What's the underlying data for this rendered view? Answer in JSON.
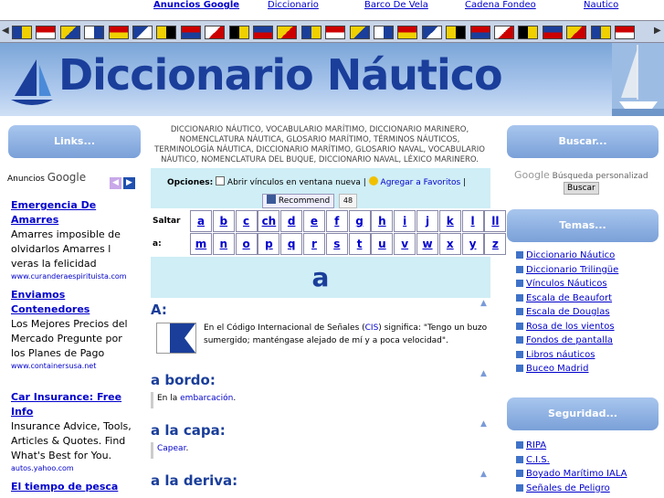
{
  "topnav": {
    "items": [
      "Anuncios Google",
      "Diccionario",
      "Barco De Vela",
      "Cadena Fondeo",
      "Nautico"
    ]
  },
  "banner": {
    "title": "Diccionario Náutico"
  },
  "left": {
    "links_label": "Links...",
    "ads_label_prefix": "Anuncios",
    "ads_label_brand": "Google",
    "ads": [
      {
        "headline": "Emergencia De Amarres",
        "body": "Amarres imposible de olvidarlos Amarres l veras la felicidad",
        "url": "www.curanderaespirituista.com"
      },
      {
        "headline": "Enviamos Contenedores",
        "body": "Los Mejores Precios del Mercado Pregunte por los Planes de Pago",
        "url": "www.containersusa.net"
      },
      {
        "headline": "Car Insurance: Free Info",
        "body": "Insurance Advice, Tools, Articles & Quotes. Find What's Best for You.",
        "url": "autos.yahoo.com"
      },
      {
        "headline": "El tiempo de pesca",
        "body": "",
        "url": ""
      }
    ]
  },
  "center": {
    "description": "DICCIONARIO NÁUTICO, VOCABULARIO MARÍTIMO, DICCIONARIO MARINERO, NOMENCLATURA NÁUTICA, GLOSARIO MARÍTIMO, TÉRMINOS NÁUTICOS, TERMINOLOGÍA NÁUTICA, DICCIONARIO MARÍTIMO, GLOSARIO NAVAL, VOCABULARIO NÁUTICO, NOMENCLATURA DEL BUQUE, DICCIONARIO NAVAL, LÉXICO MARINERO.",
    "options_label": "Opciones:",
    "new_window_label": "Abrir vínculos en ventana nueva |",
    "favorites_label": "Agregar a Favoritos",
    "fb_label": "Recommend",
    "fb_count": "48",
    "jump_label": "Saltar a:",
    "letters_row1": [
      "a",
      "b",
      "c",
      "ch",
      "d",
      "e",
      "f",
      "g",
      "h",
      "i",
      "j",
      "k",
      "l",
      "ll"
    ],
    "letters_row2": [
      "m",
      "n",
      "o",
      "p",
      "q",
      "r",
      "s",
      "t",
      "u",
      "v",
      "w",
      "x",
      "y",
      "z"
    ],
    "current_letter": "a",
    "entries": [
      {
        "term": "A:",
        "definition_pre": "En el Código Internacional de Señales (",
        "definition_link": "CIS",
        "definition_post": ") significa: \"Tengo un buzo sumergido; manténgase alejado de mí y a poca velocidad\"."
      },
      {
        "term": "a bordo:",
        "definition_pre": "En la ",
        "definition_link": "embarcación",
        "definition_post": "."
      },
      {
        "term": "a la capa:",
        "definition_pre": "",
        "definition_link": "Capear",
        "definition_post": "."
      },
      {
        "term": "a la deriva:",
        "definition_pre": "",
        "definition_link": "",
        "definition_post": ""
      }
    ]
  },
  "right": {
    "search_label": "Buscar...",
    "search_google": "Google",
    "search_caption": "Búsqueda personalizad",
    "search_button": "Buscar",
    "temas_label": "Temas...",
    "temas": [
      "Diccionario Náutico",
      "Diccionario Trilingüe",
      "Vínculos Náuticos",
      "Escala de Beaufort",
      "Escala de Douglas",
      "Rosa de los vientos",
      "Fondos de pantalla",
      "Libros náuticos",
      "Buceo Madrid"
    ],
    "seguridad_label": "Seguridad...",
    "seguridad": [
      "RIPA",
      "C.I.S.",
      "Boyado Marítimo IALA",
      "Señales de Peligro"
    ]
  }
}
